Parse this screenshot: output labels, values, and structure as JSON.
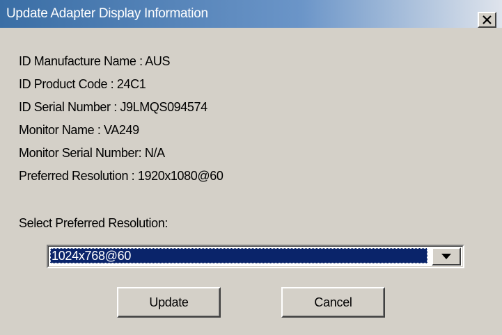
{
  "window": {
    "title": "Update Adapter Display Information"
  },
  "info": {
    "manufacture_name": "ID Manufacture Name : AUS",
    "product_code": "ID Product Code : 24C1",
    "serial_number": "ID Serial Number : J9LMQS094574",
    "monitor_name": "Monitor Name : VA249",
    "monitor_serial_number": "Monitor Serial Number: N/A",
    "preferred_resolution": "Preferred Resolution : 1920x1080@60"
  },
  "resolution_select": {
    "label": "Select Preferred Resolution:",
    "selected_value": "1024x768@60"
  },
  "buttons": {
    "update_label": "Update",
    "cancel_label": "Cancel"
  },
  "icons": {
    "close": "close-icon",
    "dropdown": "chevron-down-icon"
  },
  "colors": {
    "titlebar_start": "#3a6ea5",
    "titlebar_end": "#dfe4ec",
    "window_background": "#d4d0c8",
    "selection_highlight": "#0a246a"
  }
}
